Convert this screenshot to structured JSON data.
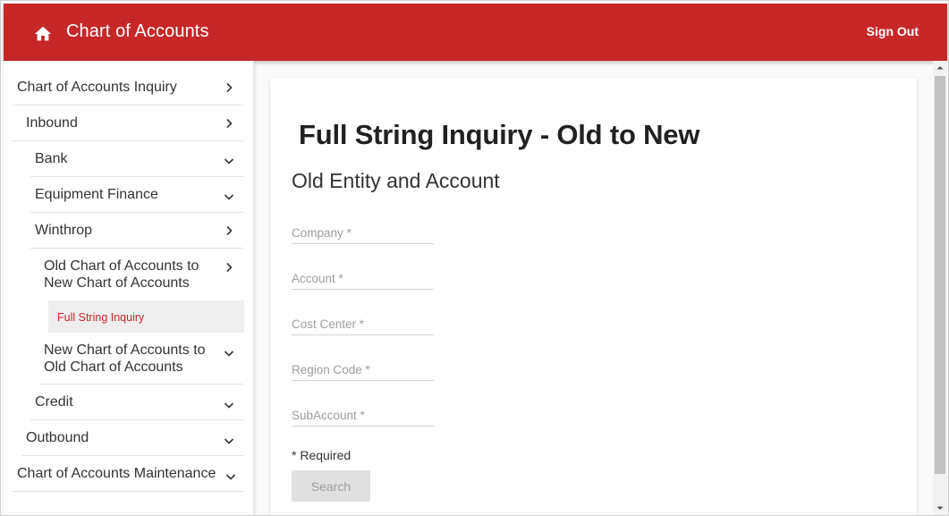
{
  "header": {
    "title": "Chart of Accounts",
    "sign_out_label": "Sign Out",
    "home_icon": "home-icon",
    "color": "#c62828"
  },
  "sidebar": {
    "items": [
      {
        "label": "Chart of Accounts Inquiry",
        "chevron": "right"
      },
      {
        "label": "Inbound",
        "chevron": "right"
      },
      {
        "label": "Bank",
        "chevron": "down"
      },
      {
        "label": "Equipment Finance",
        "chevron": "down"
      },
      {
        "label": "Winthrop",
        "chevron": "right"
      },
      {
        "label_line1": "Old Chart of Accounts to",
        "label_line2": "New Chart of Accounts",
        "chevron": "right"
      },
      {
        "label": "Full String Inquiry",
        "active": true
      },
      {
        "label_line1": "New Chart of Accounts to",
        "label_line2": "Old Chart of Accounts",
        "chevron": "down"
      },
      {
        "label": "Credit",
        "chevron": "down"
      },
      {
        "label": "Outbound",
        "chevron": "down"
      },
      {
        "label": "Chart of Accounts Maintenance",
        "chevron": "down"
      }
    ]
  },
  "main": {
    "page_title": "Full String Inquiry - Old to New",
    "section_title": "Old Entity and Account",
    "fields": [
      {
        "placeholder": "Company *"
      },
      {
        "placeholder": "Account *"
      },
      {
        "placeholder": "Cost Center *"
      },
      {
        "placeholder": "Region Code *"
      },
      {
        "placeholder": "SubAccount *"
      }
    ],
    "required_note": "* Required",
    "search_label": "Search"
  }
}
